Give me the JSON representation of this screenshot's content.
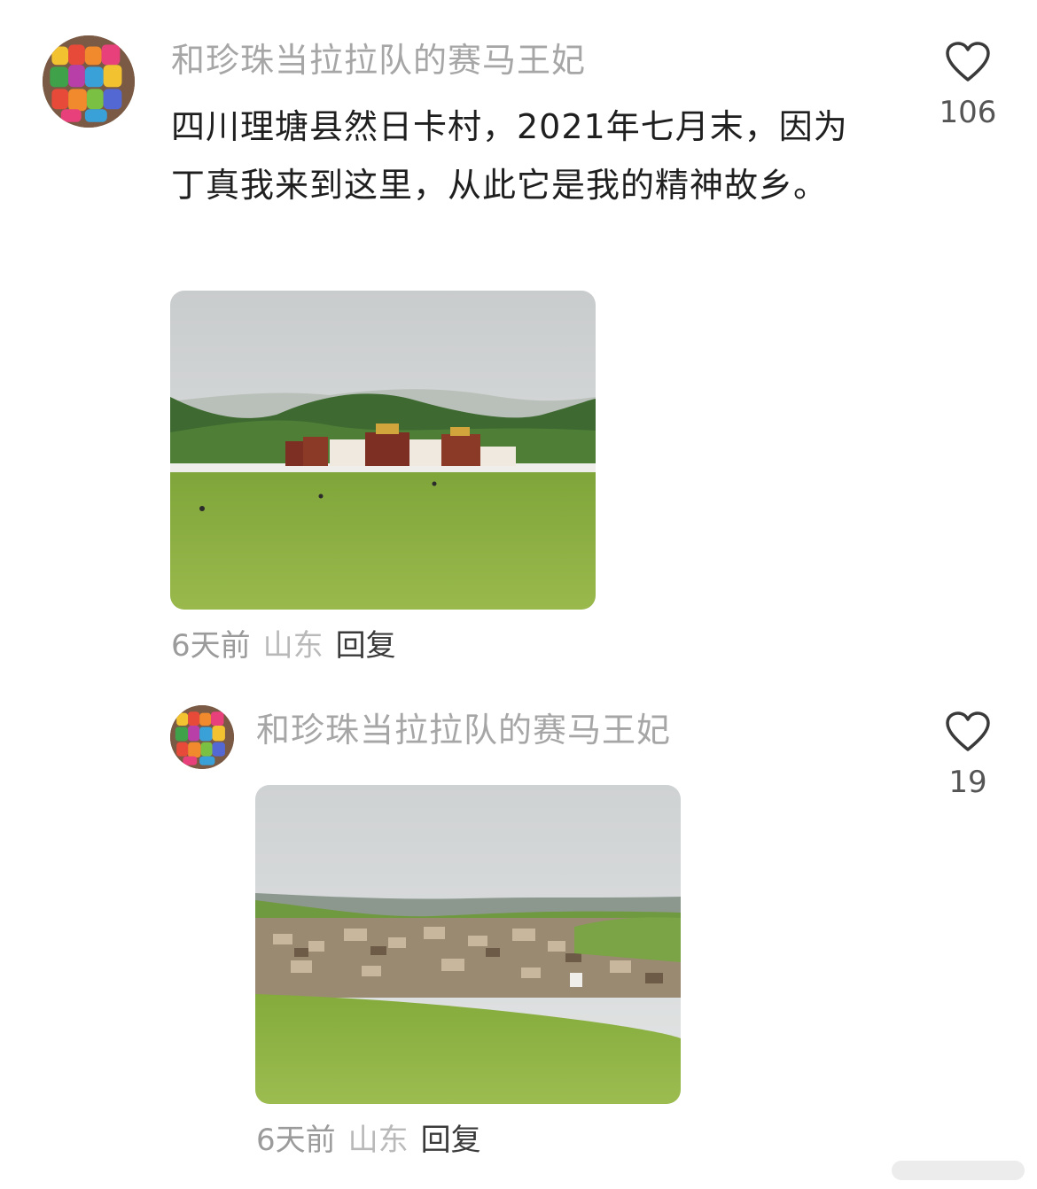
{
  "comment": {
    "username": "和珍珠当拉拉队的赛马王妃",
    "text": "四川理塘县然日卡村，2021年七月末，因为丁真我来到这里，从此它是我的精神故乡。",
    "likes": "106",
    "time": "6天前",
    "location": "山东",
    "reply_label": "回复",
    "icons": {
      "like": "heart-outline-icon"
    }
  },
  "reply": {
    "username": "和珍珠当拉拉队的赛马王妃",
    "likes": "19",
    "time": "6天前",
    "location": "山东",
    "reply_label": "回复",
    "icons": {
      "like": "heart-outline-icon"
    }
  },
  "colors": {
    "username": "#a6a6a6",
    "text": "#1f1f1f",
    "meta": "#9b9b9b",
    "sky": "#d6d9da",
    "grass": "#8db142",
    "hills": "#3f6b33"
  }
}
